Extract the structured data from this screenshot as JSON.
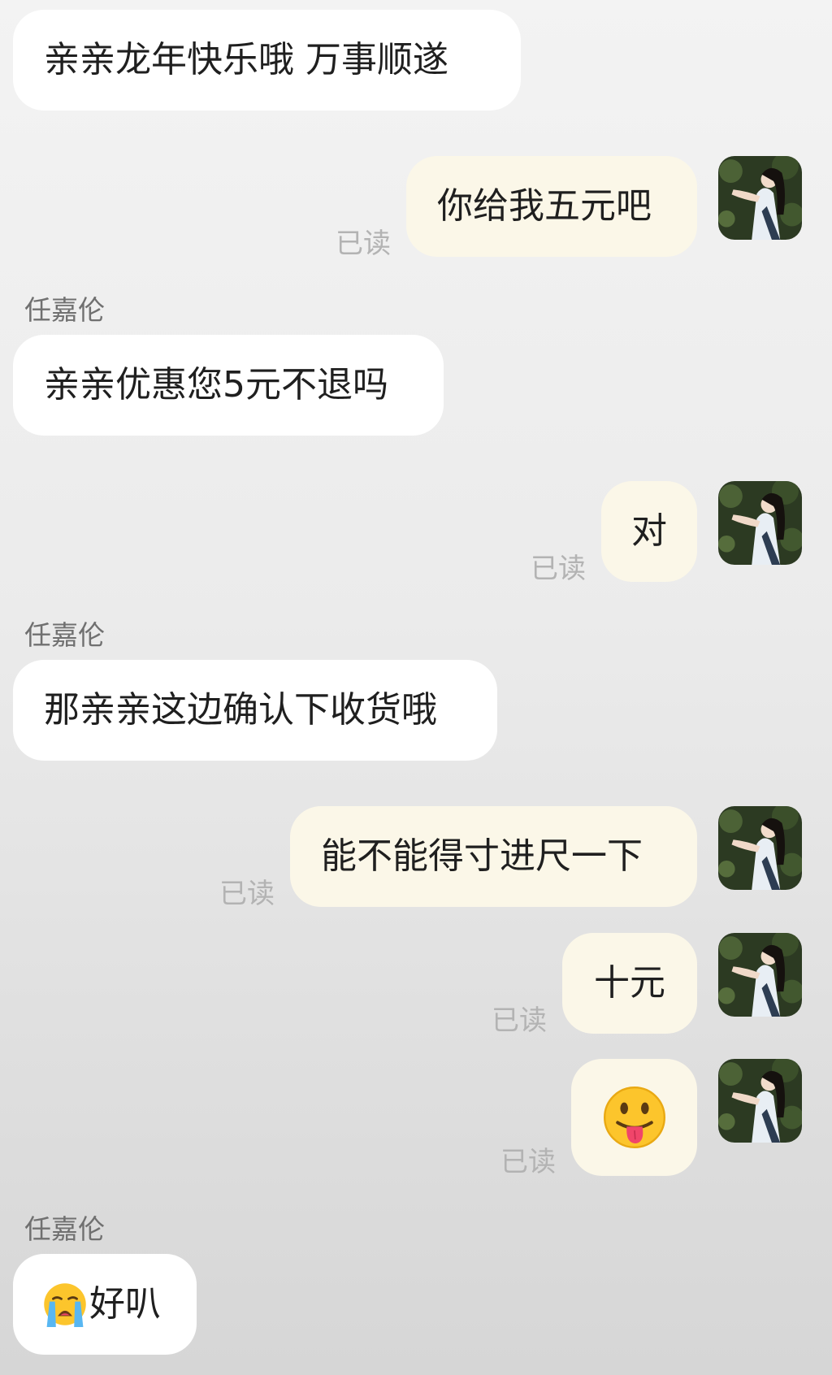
{
  "messages": [
    {
      "id": 1,
      "side": "in",
      "sender": "",
      "text": "亲亲龙年快乐哦  万事顺遂"
    },
    {
      "id": 2,
      "side": "out",
      "read": "已读",
      "text": "你给我五元吧"
    },
    {
      "id": 3,
      "side": "in",
      "sender": "任嘉伦",
      "text": "亲亲优惠您5元不退吗"
    },
    {
      "id": 4,
      "side": "out",
      "read": "已读",
      "text": "对"
    },
    {
      "id": 5,
      "side": "in",
      "sender": "任嘉伦",
      "text": "那亲亲这边确认下收货哦"
    },
    {
      "id": 6,
      "side": "out",
      "read": "已读",
      "text": "能不能得寸进尺一下"
    },
    {
      "id": 7,
      "side": "out",
      "read": "已读",
      "text": "十元"
    },
    {
      "id": 8,
      "side": "out",
      "read": "已读",
      "emoji": "tongue-out-emoji"
    },
    {
      "id": 9,
      "side": "in",
      "sender": "任嘉伦",
      "emoji": "loudly-crying-emoji",
      "text": "好叭"
    }
  ],
  "avatar": "user-avatar-photo",
  "colors": {
    "incoming_bubble": "#ffffff",
    "outgoing_bubble": "#fbf7e8",
    "read_receipt": "#b3b3b3",
    "sender_name": "#707070"
  }
}
